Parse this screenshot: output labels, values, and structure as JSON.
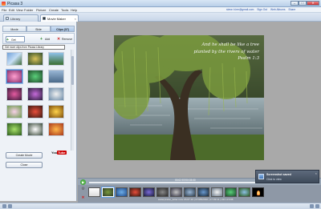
{
  "window": {
    "title": "Picasa 3",
    "controls": {
      "minimize": "–",
      "maximize": "□",
      "close": "✕"
    }
  },
  "menu": [
    "File",
    "Edit",
    "View",
    "Folder",
    "Picture",
    "Create",
    "Tools",
    "Help"
  ],
  "user": {
    "email": "steve.h.lee@gmail.com",
    "links": [
      "Sign Out",
      "Web Albums",
      "Share"
    ]
  },
  "tabs": [
    {
      "label": "Library",
      "active": false
    },
    {
      "label": "Movie Maker",
      "active": true,
      "close": "×"
    }
  ],
  "panel": {
    "subtabs": [
      {
        "label": "Movie",
        "active": false
      },
      {
        "label": "Slide",
        "active": false
      },
      {
        "label": "Clips (37)",
        "active": true
      }
    ],
    "toolbar": {
      "get_more": "Get More...",
      "add": "Add",
      "remove": "Remove",
      "get_more_icon": "+",
      "add_icon": "+",
      "remove_icon": "✕"
    },
    "tooltip": "Get more clips from Picasa Library",
    "buttons": {
      "create_movie": "Create Movie",
      "close": "Close"
    },
    "youtube": {
      "you": "You",
      "tube": "Tube"
    }
  },
  "preview": {
    "caption_lines": [
      "And he shall be like a tree",
      "planted by the rivers of water",
      "Psalm 1:3"
    ]
  },
  "player": {
    "play_icon": "▶",
    "time": "00:02:57/00:03:00"
  },
  "filmstrip": {
    "caption": "waterpraise_letter.mov  23.07.23 | 07/05/2010 | 17:09:11 | 221 of 246",
    "gear_icon": "⚙",
    "delete_icon": "✕"
  },
  "notification": {
    "title": "Screenshot saved",
    "subtitle": "Click to view",
    "close": "×"
  },
  "colors": {
    "accent": "#5e9be0",
    "panel": "#eef2f7",
    "canvas": "#a9a9a9"
  }
}
